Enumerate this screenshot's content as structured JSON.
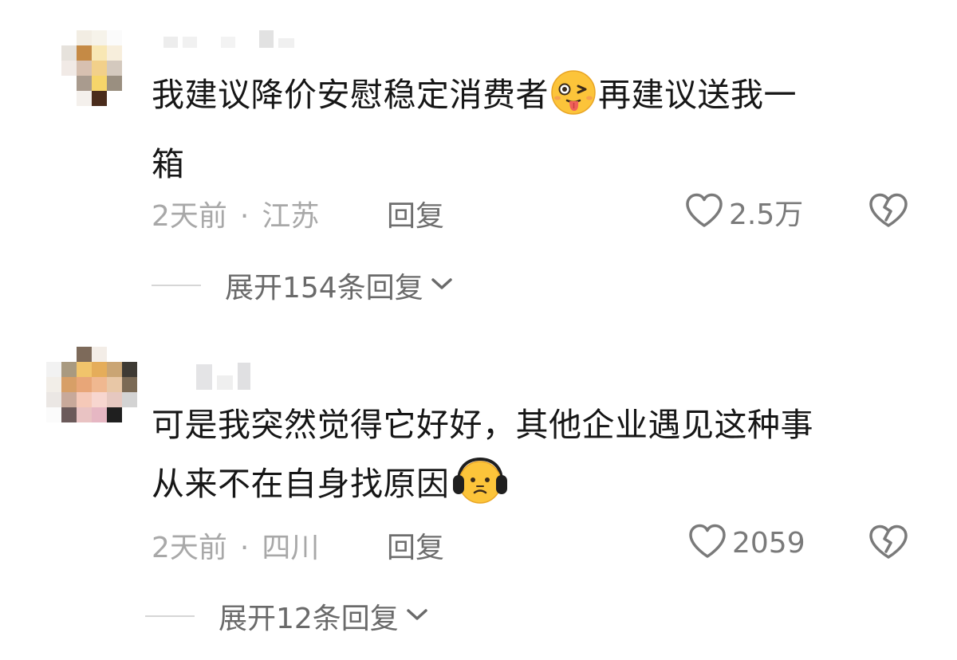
{
  "comments": [
    {
      "text_line1": "我建议降价安慰稳定消费者",
      "emoji1": "winking-tongue-face",
      "text_line1_after": "再建议送我一",
      "text_line2": "箱",
      "time": "2天前",
      "separator": "·",
      "location": "江苏",
      "reply_label": "回复",
      "like_count": "2.5万",
      "expand_label": "展开154条回复"
    },
    {
      "text_line1": "可是我突然觉得它好好，其他企业遇见这种事",
      "text_line2": "从来不在自身找原因",
      "emoji2": "headphones-frown-face",
      "time": "2天前",
      "separator": "·",
      "location": "四川",
      "reply_label": "回复",
      "like_count": "2059",
      "expand_label": "展开12条回复"
    }
  ],
  "icons": {
    "like": "heart-outline-icon",
    "dislike": "broken-heart-icon",
    "expand": "chevron-down-icon"
  },
  "colors": {
    "text": "#161616",
    "meta": "#a8a8a8",
    "emoji_yellow": "#fcc43a"
  }
}
